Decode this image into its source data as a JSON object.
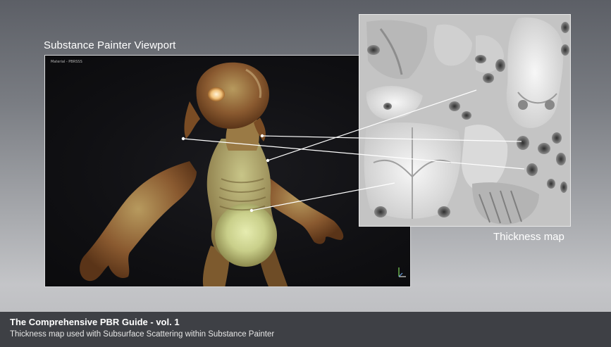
{
  "viewport": {
    "title": "Substance Painter Viewport",
    "material_label": "Material - PBRSSS"
  },
  "thickness_map": {
    "label": "Thickness map"
  },
  "footer": {
    "title": "The Comprehensive PBR Guide - vol. 1",
    "subtitle": "Thickness map used with Subsurface Scattering within Substance Painter"
  },
  "icons": {
    "axis_gizmo": "axis-gizmo-icon"
  }
}
